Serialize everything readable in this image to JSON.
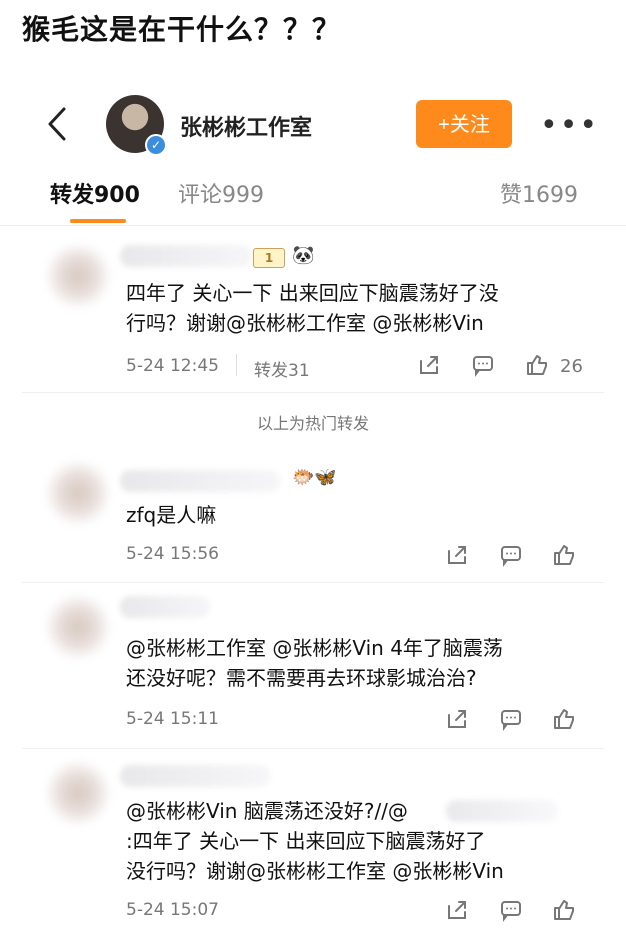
{
  "caption": "猴毛这是在干什么？？？",
  "header": {
    "account_name": "张彬彬工作室",
    "follow_label": "+关注",
    "more_label": "•••"
  },
  "tabs": [
    {
      "label": "转发900"
    },
    {
      "label": "评论999"
    },
    {
      "label": "赞1699"
    }
  ],
  "colors": {
    "accent": "#ff8a1c",
    "verified": "#3d8ddf"
  },
  "posts": [
    {
      "text_line1": "四年了 关心一下 出来回应下脑震荡好了没",
      "text_line2": "行吗？谢谢@张彬彬工作室 @张彬彬Vin",
      "time": "5-24 12:45",
      "repost": "转发31",
      "likes": "26",
      "badge": "1",
      "emoji": "🐼"
    },
    {
      "text_line1": "zfq是人嘛",
      "time": "5-24 15:56",
      "emoji": "🐡🦋"
    },
    {
      "text_line1": "@张彬彬工作室 @张彬彬Vin 4年了脑震荡",
      "text_line2": "还没好呢？需不需要再去环球影城治治?",
      "time": "5-24 15:11"
    },
    {
      "text_line1": "@张彬彬Vin 脑震荡还没好?//@",
      "text_line2": ":四年了 关心一下 出来回应下脑震荡好了",
      "text_line3": "没行吗？谢谢@张彬彬工作室 @张彬彬Vin",
      "time": "5-24 15:07"
    }
  ],
  "divider_label": "以上为热门转发"
}
